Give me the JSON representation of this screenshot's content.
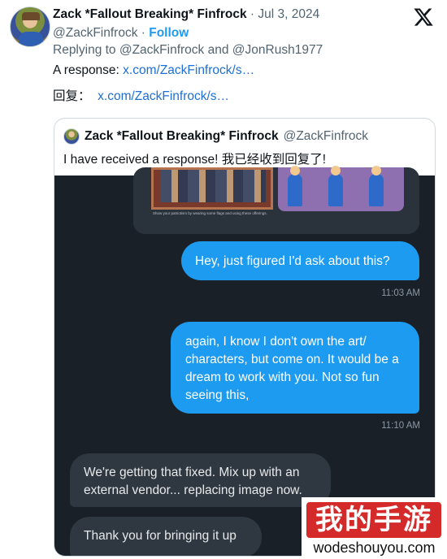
{
  "tweet": {
    "author_name": "Zack *Fallout Breaking* Finfrock",
    "separator": "·",
    "date": "Jul 3, 2024",
    "handle": "@ZackFinfrock",
    "follow_label": "Follow",
    "replying_prefix": "Replying to ",
    "replying_to_1": "@ZackFinfrock",
    "replying_and": " and ",
    "replying_to_2": "@JonRush1977",
    "response_label": "A response: ",
    "response_link": "x.com/ZackFinfrock/s…",
    "response_label_cn": "回复：",
    "response_link_cn": "x.com/ZackFinfrock/s…"
  },
  "quote": {
    "author_name": "Zack *Fallout Breaking* Finfrock",
    "handle": "@ZackFinfrock",
    "text": "I have received a response! 我已经收到回复了!"
  },
  "chat": {
    "image_caption": "Show your patriotism by wearing some flags and using these offerings.",
    "messages": [
      {
        "text": "Hey, just figured I'd ask about this?",
        "time": "11:03 AM"
      },
      {
        "text": "again, I know I don't own the art/ characters, but come on. It would be a dream to work with you. Not so fun seeing this,",
        "time": "11:10 AM"
      },
      {
        "text": "We're getting that fixed.  Mix up with an external vendor... replacing image now."
      },
      {
        "text": "Thank you for bringing it up"
      }
    ]
  },
  "watermark": {
    "cn": "我的手游",
    "url": "wodeshouyou.com"
  },
  "icons": {
    "logo": "x-logo-icon"
  }
}
